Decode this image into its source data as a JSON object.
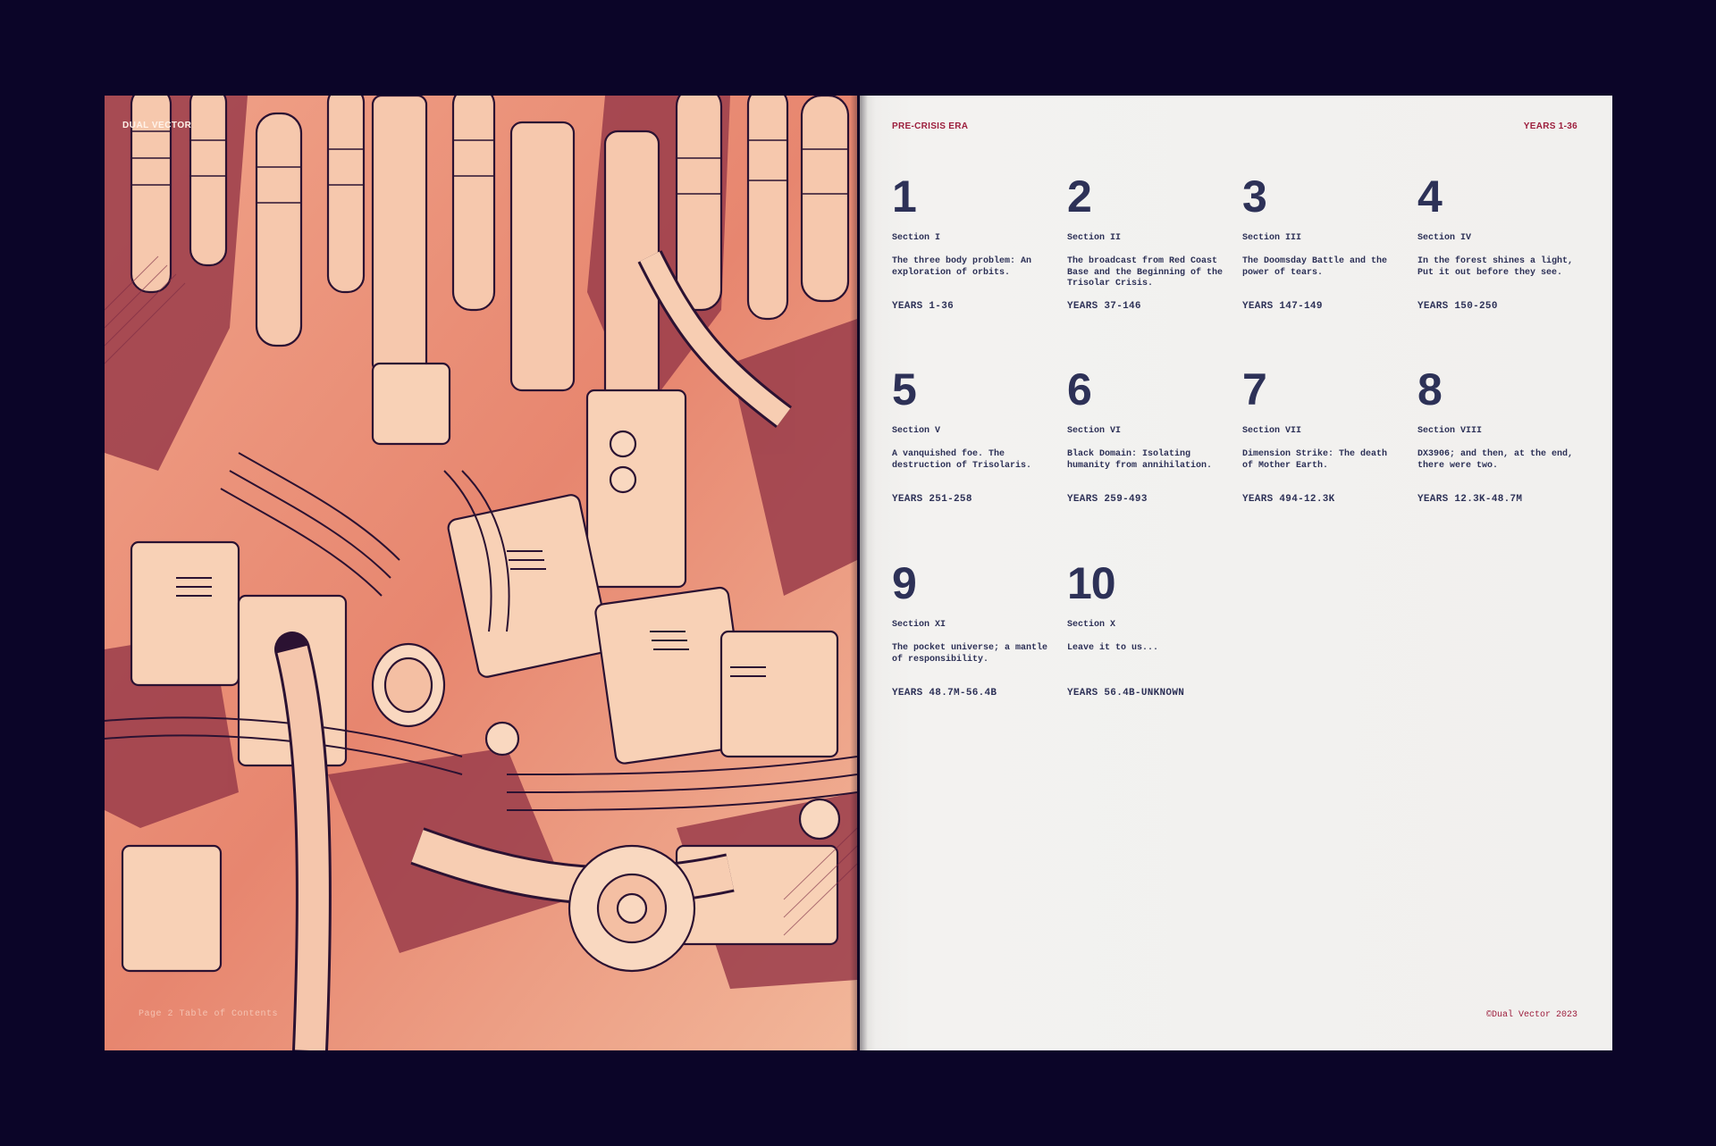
{
  "left_page": {
    "brand": "DUAL VECTOR",
    "footer": "Page 2  Table of Contents",
    "illustration": "illustration"
  },
  "right_page": {
    "era": "PRE-CRISIS ERA",
    "years_range": "YEARS 1-36",
    "copyright": "©Dual Vector 2023",
    "items": [
      {
        "num": "1",
        "section": "Section I",
        "desc": "The three body problem: An exploration of orbits.",
        "years": "YEARS 1-36"
      },
      {
        "num": "2",
        "section": "Section II",
        "desc": "The broadcast from Red Coast Base and the Beginning of the Trisolar Crisis.",
        "years": "YEARS 37-146"
      },
      {
        "num": "3",
        "section": "Section III",
        "desc": "The Doomsday Battle and the power of tears.",
        "years": "YEARS 147-149"
      },
      {
        "num": "4",
        "section": "Section IV",
        "desc": "In the forest shines a light, Put it out before they see.",
        "years": "YEARS 150-250"
      },
      {
        "num": "5",
        "section": "Section V",
        "desc": "A vanquished foe. The destruction of Trisolaris.",
        "years": "YEARS 251-258"
      },
      {
        "num": "6",
        "section": "Section VI",
        "desc": "Black Domain: Isolating humanity from annihilation.",
        "years": "YEARS 259-493"
      },
      {
        "num": "7",
        "section": "Section VII",
        "desc": "Dimension Strike: The death of Mother Earth.",
        "years": "YEARS 494-12.3K"
      },
      {
        "num": "8",
        "section": "Section VIII",
        "desc": "DX3906; and then, at the end, there were two.",
        "years": "YEARS 12.3K-48.7M"
      },
      {
        "num": "9",
        "section": "Section XI",
        "desc": "The pocket universe; a mantle of responsibility.",
        "years": "YEARS 48.7M-56.4B"
      },
      {
        "num": "10",
        "section": "Section X",
        "desc": "Leave it to us...",
        "years": "YEARS 56.4B-UNKNOWN"
      }
    ]
  },
  "colors": {
    "background": "#0b0528",
    "illustration_base": "#e98a72",
    "ink": "#2d3157",
    "accent": "#9c1d3c",
    "paper": "#f1f0ee"
  }
}
